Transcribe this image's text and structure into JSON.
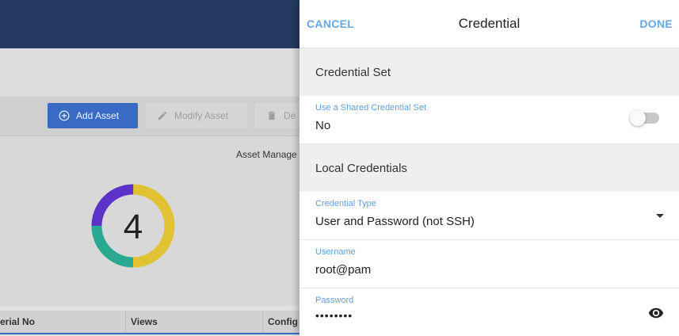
{
  "background": {
    "toolbar": {
      "add_asset": "Add Asset",
      "modify_asset": "Modify Asset",
      "delete_asset": "De"
    },
    "chart": {
      "title": "Asset Manage",
      "count": "4"
    },
    "table": {
      "columns": [
        "erial No",
        "Views",
        "Config N"
      ]
    }
  },
  "panel": {
    "title": "Credential",
    "cancel_label": "CANCEL",
    "done_label": "DONE",
    "sections": {
      "credential_set": "Credential Set",
      "local_credentials": "Local Credentials"
    },
    "shared": {
      "label": "Use a Shared Credential Set",
      "value": "No",
      "enabled": false
    },
    "credential_type": {
      "label": "Credential Type",
      "value": "User and Password (not SSH)"
    },
    "username": {
      "label": "Username",
      "value": "root@pam"
    },
    "password": {
      "label": "Password",
      "value": "••••••••"
    }
  },
  "colors": {
    "header_bg": "#243a62",
    "primary_button": "#3a6bc4",
    "accent_text": "#64a8e6",
    "donut_segments": [
      "#e0c232",
      "#2aa891",
      "#5c32c8"
    ]
  }
}
